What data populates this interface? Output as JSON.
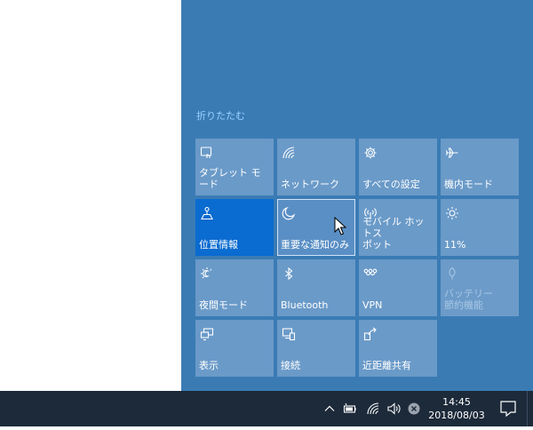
{
  "action_center": {
    "collapse_label": "折りたたむ",
    "tiles": [
      {
        "label": "タブレット モード",
        "icon": "tablet-mode-icon",
        "state": "normal"
      },
      {
        "label": "ネットワーク",
        "icon": "network-icon",
        "state": "normal"
      },
      {
        "label": "すべての設定",
        "icon": "settings-gear-icon",
        "state": "normal"
      },
      {
        "label": "機内モード",
        "icon": "airplane-icon",
        "state": "normal"
      },
      {
        "label": "位置情報",
        "icon": "location-icon",
        "state": "active"
      },
      {
        "label": "重要な通知のみ",
        "icon": "moon-icon",
        "state": "hover"
      },
      {
        "label": "モバイル ホットス\nポット",
        "icon": "hotspot-icon",
        "state": "normal"
      },
      {
        "label": "11%",
        "icon": "brightness-icon",
        "state": "normal"
      },
      {
        "label": "夜間モード",
        "icon": "night-light-icon",
        "state": "normal"
      },
      {
        "label": "Bluetooth",
        "icon": "bluetooth-icon",
        "state": "normal"
      },
      {
        "label": "VPN",
        "icon": "vpn-icon",
        "state": "normal"
      },
      {
        "label": "バッテリー\n節約機能",
        "icon": "battery-saver-icon",
        "state": "disabled"
      },
      {
        "label": "表示",
        "icon": "project-icon",
        "state": "normal"
      },
      {
        "label": "接続",
        "icon": "connect-icon",
        "state": "normal"
      },
      {
        "label": "近距離共有",
        "icon": "nearby-share-icon",
        "state": "normal"
      }
    ]
  },
  "taskbar": {
    "time": "14:45",
    "date": "2018/08/03",
    "tray_icons": [
      "chevron-up-icon",
      "battery-icon",
      "wifi-icon",
      "volume-icon",
      "cancel-icon"
    ]
  },
  "colors": {
    "panel_bg": "#3a7bb4",
    "tile_bg": "#6a9ac8",
    "tile_active": "#0a6bd0",
    "taskbar_bg": "#1d2a3a",
    "collapse_link": "#9bd0ff"
  }
}
